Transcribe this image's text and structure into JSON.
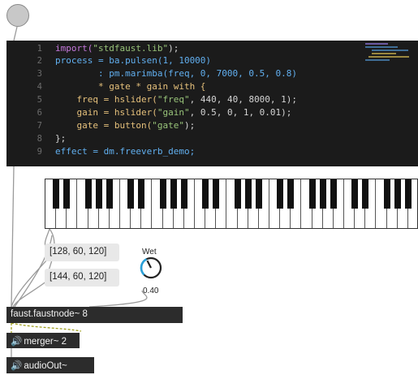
{
  "code": {
    "line_numbers": [
      "1",
      "2",
      "3",
      "4",
      "5",
      "6",
      "7",
      "8",
      "9"
    ],
    "lines": [
      [
        "import(",
        "\"stdfaust.lib\"",
        ");"
      ],
      [
        "process = ba.pulsen(1, 10000)"
      ],
      [
        "        : pm.marimba(freq, 0, 7000, 0.5, 0.8)"
      ],
      [
        "        * gate * gain with {"
      ],
      [
        "    freq = hslider(",
        "\"freq\"",
        ", 440, 40, 8000, 1);"
      ],
      [
        "    gain = hslider(",
        "\"gain\"",
        ", 0.5, 0, 1, 0.01);"
      ],
      [
        "    gate = button(",
        "\"gate\"",
        ");"
      ],
      [
        "};"
      ],
      [
        "effect = dm.freeverb_demo;"
      ]
    ]
  },
  "messages": {
    "msg1": "[128, 60, 120]",
    "msg2": "[144, 60, 120]"
  },
  "dial": {
    "label": "Wet",
    "value": "0.40",
    "level": 0.4
  },
  "objects": {
    "faustnode": "faust.faustnode~ 8",
    "merger": "merger~ 2",
    "audioout": "audioOut~"
  },
  "colors": {
    "editor_bg": "#1b1b1b",
    "dial_accent": "#2aa0d8",
    "object_bg": "#2c2c2c"
  }
}
